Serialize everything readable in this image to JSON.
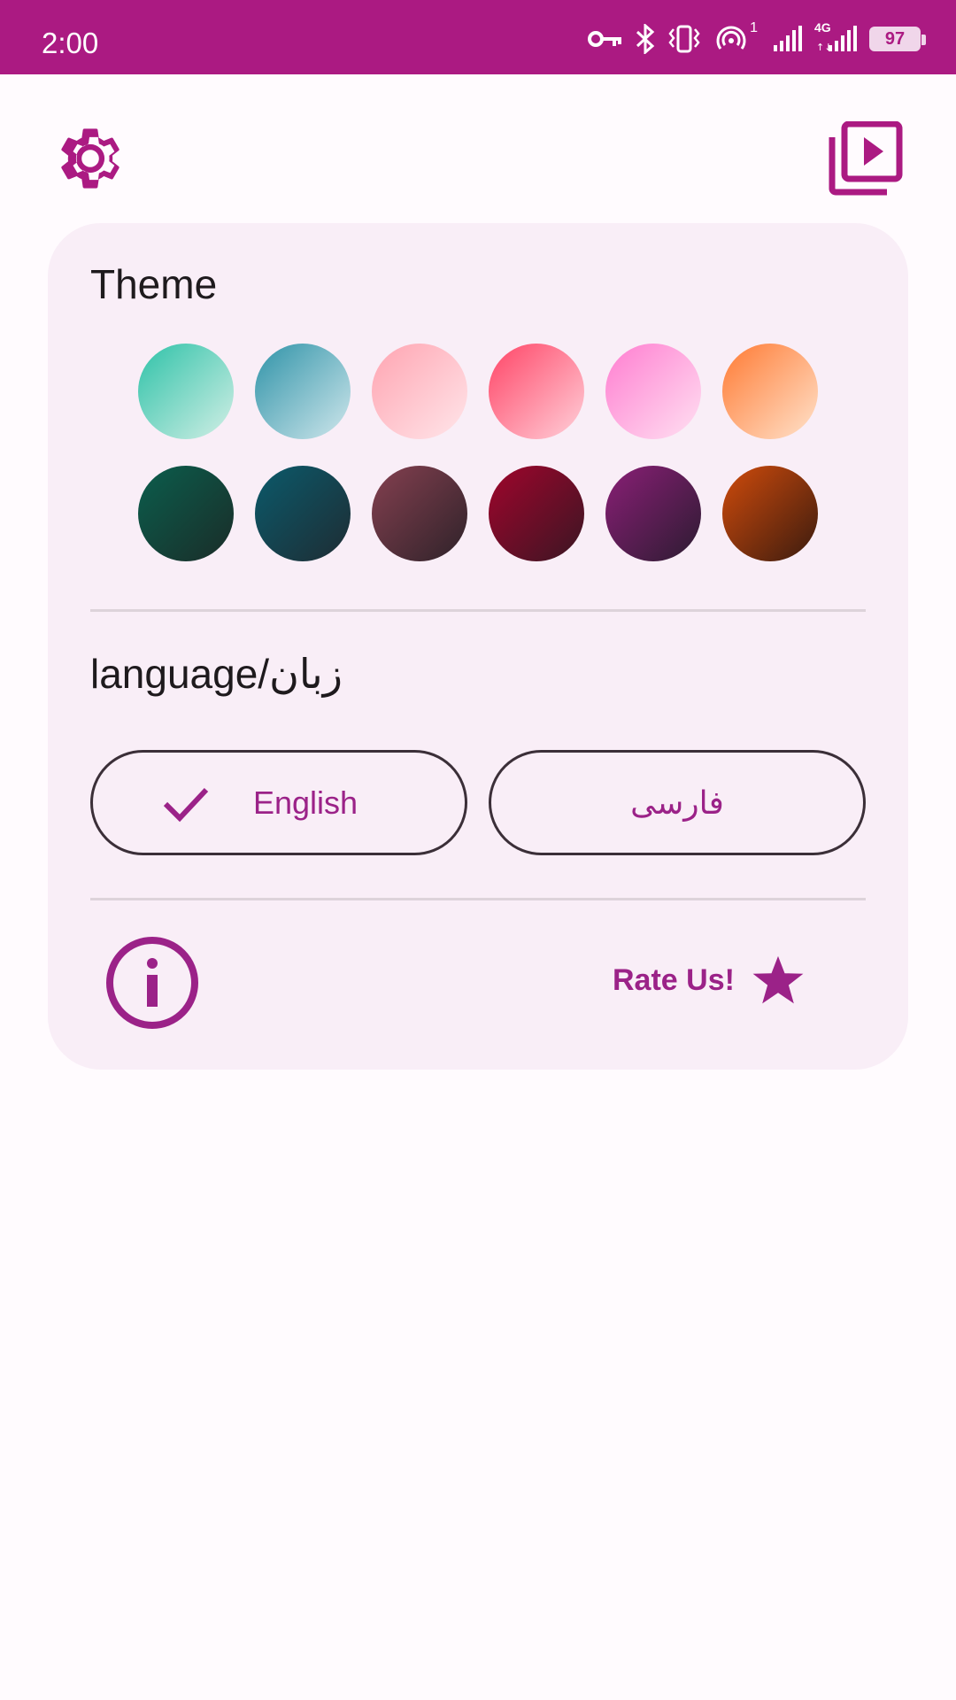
{
  "status_bar": {
    "time": "2:00",
    "battery_level": "97",
    "icons": [
      "vpn-key-icon",
      "bluetooth-icon",
      "vibrate-icon",
      "hotspot-icon",
      "signal-icon",
      "signal-4g-icon",
      "battery-icon"
    ],
    "hotspot_count": "1",
    "network_type": "4G"
  },
  "toolbar": {
    "left_icon": "settings-gear-icon",
    "right_icon": "video-library-icon"
  },
  "theme": {
    "title": "Theme",
    "swatches_row1": [
      {
        "from": "#2ec2a8",
        "to": "#d3efe6"
      },
      {
        "from": "#2f93a8",
        "to": "#d0e7ec"
      },
      {
        "from": "#ffa4b1",
        "to": "#ffe6ea"
      },
      {
        "from": "#ff4466",
        "to": "#ffd1da"
      },
      {
        "from": "#ff7dd0",
        "to": "#ffe1f2"
      },
      {
        "from": "#ff7a33",
        "to": "#ffe3cc"
      }
    ],
    "swatches_row2": [
      {
        "from": "#0b5e4d",
        "to": "#1a2c28"
      },
      {
        "from": "#0b5a6b",
        "to": "#1e2c33"
      },
      {
        "from": "#854050",
        "to": "#2e2229"
      },
      {
        "from": "#a0052c",
        "to": "#3a1623"
      },
      {
        "from": "#8a1e76",
        "to": "#2c1c31"
      },
      {
        "from": "#d04b0c",
        "to": "#3a1b0e"
      }
    ]
  },
  "language": {
    "title": "language/زبان",
    "options": [
      {
        "label": "English",
        "selected": true
      },
      {
        "label": "فارسی",
        "selected": false
      }
    ]
  },
  "footer": {
    "info_icon": "info-icon",
    "rate_label": "Rate Us!",
    "rate_icon": "star-icon"
  },
  "colors": {
    "accent": "#ab1a82",
    "accent_text": "#9b2288",
    "card_bg": "#f9eef7",
    "page_bg": "#fffbfe"
  }
}
